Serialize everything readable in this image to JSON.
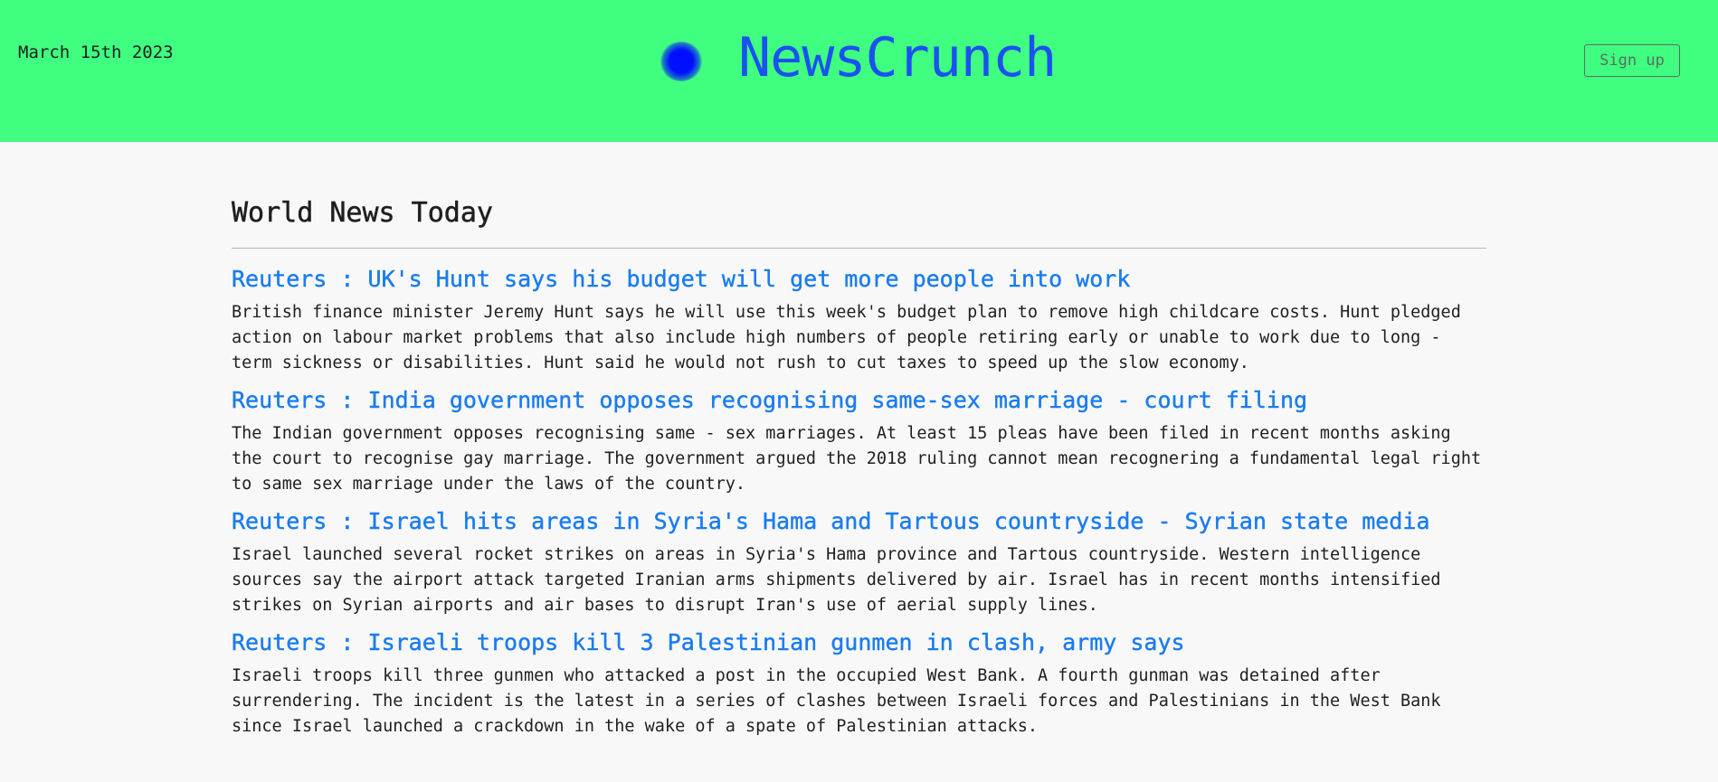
{
  "header": {
    "date": "March 15th 2023",
    "brand": "NewsCrunch",
    "signup_label": "Sign up"
  },
  "colors": {
    "header_bg": "#40ff80",
    "brand": "#1a52f0",
    "link": "#1a7cf0",
    "logo_dot": "#0010ff"
  },
  "main": {
    "title": "World News Today",
    "articles": [
      {
        "headline": "Reuters : UK's Hunt says his budget will get more people into work",
        "summary": "British finance minister Jeremy Hunt says he will use this week's budget plan to remove high childcare costs. Hunt pledged action on labour market problems that also include high numbers of people retiring early or unable to work due to long - term sickness or disabilities. Hunt said he would not rush to cut taxes to speed up the slow economy."
      },
      {
        "headline": "Reuters : India government opposes recognising same-sex marriage - court filing",
        "summary": "The Indian government opposes recognising same - sex marriages. At least 15 pleas have been filed in recent months asking the court to recognise gay marriage. The government argued the 2018 ruling cannot mean recognering a fundamental legal right to same sex marriage under the laws of the country."
      },
      {
        "headline": "Reuters : Israel hits areas in Syria's Hama and Tartous countryside - Syrian state media",
        "summary": "Israel launched several rocket strikes on areas in Syria's Hama province and Tartous countryside. Western intelligence sources say the airport attack targeted Iranian arms shipments delivered by air. Israel has in recent months intensified strikes on Syrian airports and air bases to disrupt Iran's use of aerial supply lines."
      },
      {
        "headline": "Reuters : Israeli troops kill 3 Palestinian gunmen in clash, army says",
        "summary": "Israeli troops kill three gunmen who attacked a post in the occupied West Bank. A fourth gunman was detained after surrendering. The incident is the latest in a series of clashes between Israeli forces and Palestinians in the West Bank since Israel launched a crackdown in the wake of a spate of Palestinian attacks."
      }
    ]
  }
}
